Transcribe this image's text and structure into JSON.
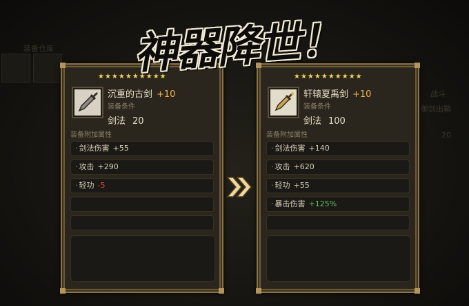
{
  "title": "神器降世！",
  "bg": {
    "topleft_label": "装备仓库",
    "right_labels": [
      "战斗",
      "御剑出鞘",
      "20"
    ]
  },
  "colors": {
    "panel_border": "#8a7242",
    "stars": "#f3d25a",
    "level": "#f1b64a",
    "negative": "#e0483a",
    "positive": "#5dc45a"
  },
  "old_weapon": {
    "stars": "★★★★★★★★★★",
    "icon": "broadsword-icon",
    "name": "沉重的古剑",
    "level": "+10",
    "req_label": "装备条件",
    "req_skill": "剑法",
    "req_value": "20",
    "attr_title": "装备附加属性",
    "attributes": [
      {
        "name": "剑法伤害",
        "value": "+55",
        "tone": "normal"
      },
      {
        "name": "攻击",
        "value": "+290",
        "tone": "normal"
      },
      {
        "name": "轻功",
        "value": "-5",
        "tone": "negative"
      }
    ]
  },
  "new_weapon": {
    "stars": "★★★★★★★★★★",
    "icon": "golden-sword-icon",
    "name": "轩辕夏禹剑",
    "level": "+10",
    "req_label": "装备条件",
    "req_skill": "剑法",
    "req_value": "100",
    "attr_title": "装备附加属性",
    "attributes": [
      {
        "name": "剑法伤害",
        "value": "+140",
        "tone": "normal"
      },
      {
        "name": "攻击",
        "value": "+620",
        "tone": "normal"
      },
      {
        "name": "轻功",
        "value": "+55",
        "tone": "normal"
      },
      {
        "name": "暴击伤害",
        "value": "+125%",
        "tone": "positive"
      }
    ]
  }
}
